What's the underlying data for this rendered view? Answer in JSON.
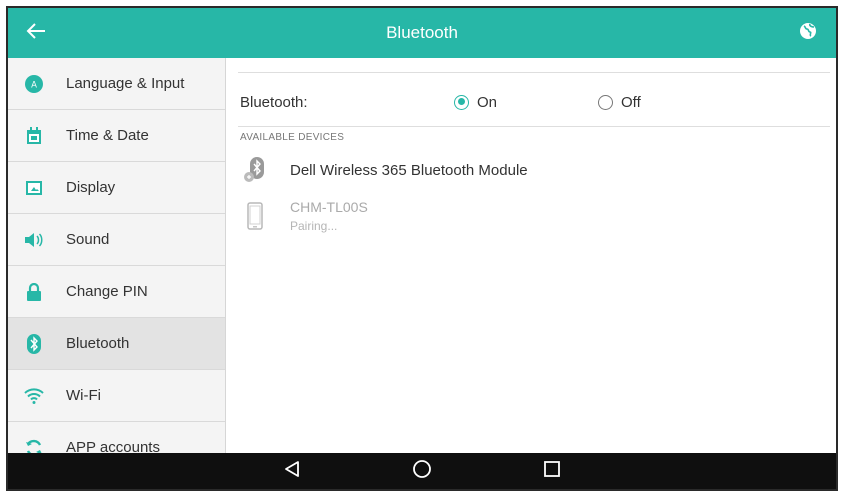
{
  "header": {
    "title": "Bluetooth",
    "back_icon": "arrow-left-icon",
    "globe_icon": "globe-icon",
    "color": "#27b7a7"
  },
  "sidebar": {
    "items": [
      {
        "label": "Language & Input",
        "icon": "language-icon",
        "color": "#27b7a7"
      },
      {
        "label": "Time & Date",
        "icon": "calendar-icon",
        "color": "#27b7a7"
      },
      {
        "label": "Display",
        "icon": "display-icon",
        "color": "#27b7a7"
      },
      {
        "label": "Sound",
        "icon": "speaker-icon",
        "color": "#27b7a7"
      },
      {
        "label": "Change PIN",
        "icon": "lock-icon",
        "color": "#27b7a7"
      },
      {
        "label": "Bluetooth",
        "icon": "bluetooth-icon",
        "color": "#27b7a7",
        "active": true
      },
      {
        "label": "Wi-Fi",
        "icon": "wifi-icon",
        "color": "#27b7a7"
      },
      {
        "label": "APP accounts",
        "icon": "sync-icon",
        "color": "#27b7a7"
      }
    ]
  },
  "main": {
    "bluetooth_label": "Bluetooth:",
    "on_label": "On",
    "off_label": "Off",
    "selected": "On",
    "section_label": "AVAILABLE DEVICES",
    "devices": [
      {
        "name": "Dell Wireless 365 Bluetooth Module",
        "icon": "bluetooth-device-icon"
      },
      {
        "name": "CHM-TL00S",
        "status": "Pairing...",
        "icon": "phone-icon"
      }
    ]
  },
  "bottom_nav": {
    "back_icon": "triangle-back-icon",
    "home_icon": "circle-home-icon",
    "recents_icon": "square-recents-icon"
  }
}
